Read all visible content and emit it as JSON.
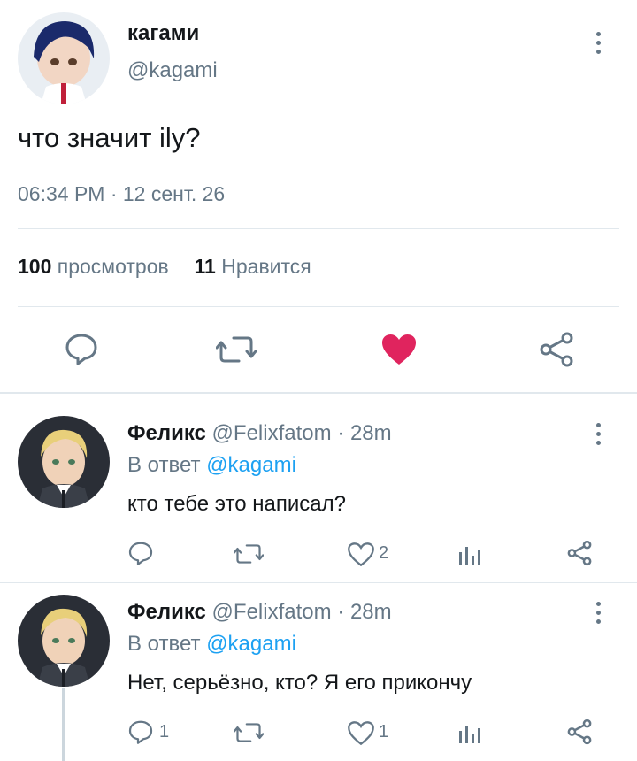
{
  "tweet": {
    "author_name": "кагами",
    "author_handle": "@kagami",
    "text": "что значит ily?",
    "timestamp": "06:34 PM · 12 сент. 26",
    "views_count": "100",
    "views_label": "просмотров",
    "likes_count": "11",
    "likes_label": "Нравится",
    "liked": true,
    "like_color": "#e0245e",
    "icons": [
      "reply-icon",
      "retweet-icon",
      "heart-filled-icon",
      "share-icon"
    ]
  },
  "replies": [
    {
      "author_name": "Феликс",
      "author_handle": "@Felixfatom",
      "age": "· 28m",
      "reply_prefix": "В ответ",
      "reply_to": "@kagami",
      "text": "кто тебе это написал?",
      "reply_count": "",
      "retweet_count": "",
      "like_count": "2"
    },
    {
      "author_name": "Феликс",
      "author_handle": "@Felixfatom",
      "age": "· 28m",
      "reply_prefix": "В ответ",
      "reply_to": "@kagami",
      "text": "Нет, серьёзно, кто? Я его прикончу",
      "reply_count": "1",
      "retweet_count": "",
      "like_count": "1"
    }
  ],
  "colors": {
    "accent": "#1da1f2",
    "muted": "#657786",
    "divider": "#e1e8ed",
    "like": "#e0245e"
  }
}
